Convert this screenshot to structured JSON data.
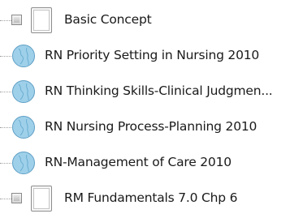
{
  "tree": {
    "items": [
      {
        "label": "Basic Concept",
        "icon": "document-icon",
        "has_checkbox": true
      },
      {
        "label": "RN Priority Setting in Nursing 2010",
        "icon": "globe-icon",
        "has_checkbox": false
      },
      {
        "label": "RN Thinking Skills-Clinical Judgmen...",
        "icon": "globe-icon",
        "has_checkbox": false
      },
      {
        "label": "RN Nursing Process-Planning 2010",
        "icon": "globe-icon",
        "has_checkbox": false
      },
      {
        "label": "RN-Management of Care 2010",
        "icon": "globe-icon",
        "has_checkbox": false
      },
      {
        "label": "RM Fundamentals 7.0 Chp 6",
        "icon": "document-icon",
        "has_checkbox": true
      }
    ]
  },
  "colors": {
    "globe_fill": "#9fd0ea",
    "globe_stroke": "#5f9fc4",
    "connector": "#a0a0a0"
  }
}
